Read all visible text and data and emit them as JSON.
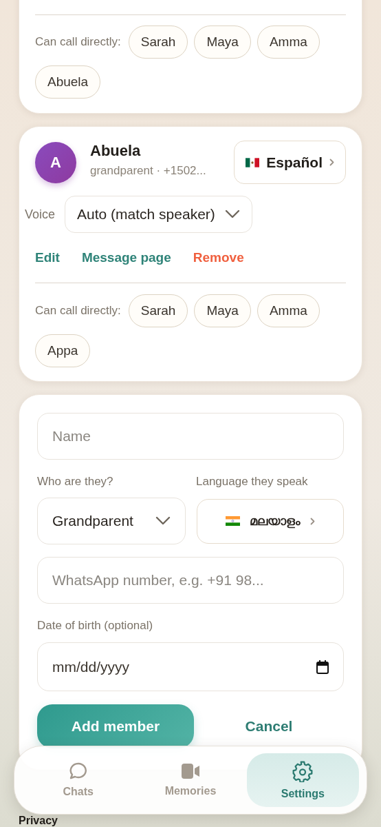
{
  "partial_member": {
    "can_call_label": "Can call directly:",
    "contacts": [
      "Sarah",
      "Maya",
      "Amma",
      "Abuela"
    ]
  },
  "member": {
    "initial": "A",
    "name": "Abuela",
    "subtitle": "grandparent · +1502...",
    "language": "Español",
    "voice_label": "Voice",
    "voice": "Auto (match speaker)",
    "actions": [
      {
        "label": "Edit",
        "kind": "normal"
      },
      {
        "label": "Message page",
        "kind": "normal"
      },
      {
        "label": "Remove",
        "kind": "danger"
      }
    ],
    "can_call_label": "Can call directly:",
    "contacts": [
      "Sarah",
      "Maya",
      "Amma",
      "Appa"
    ]
  },
  "add_form": {
    "name_placeholder": "Name",
    "relation_label": "Who are they?",
    "relation": "Grandparent",
    "language_label": "Language they speak",
    "language": "മലയാളം",
    "phone_placeholder": "WhatsApp number, e.g. +91 98...",
    "dob_label": "Date of birth (optional)",
    "dob_placeholder": "mm/dd/yyyy",
    "submit": "Add member",
    "cancel": "Cancel"
  },
  "section_heading": "Privacy",
  "nav": {
    "items": [
      {
        "label": "Chats",
        "selected": false
      },
      {
        "label": "Memories",
        "selected": false
      },
      {
        "label": "Settings",
        "selected": true
      }
    ]
  }
}
